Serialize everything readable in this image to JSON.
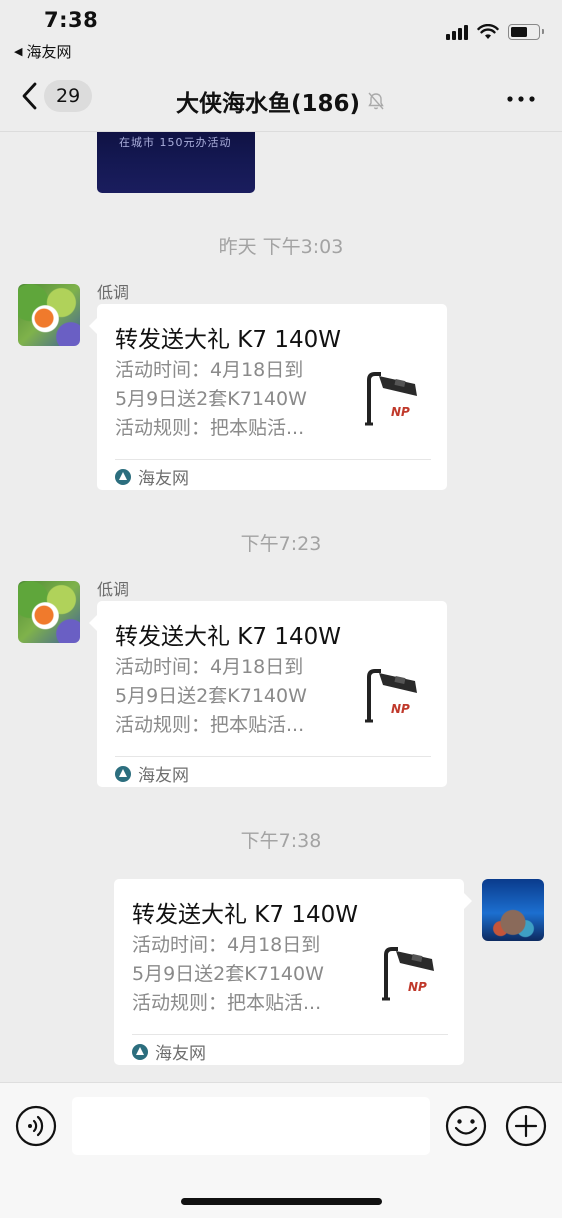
{
  "status_bar": {
    "time": "7:38",
    "back_app": "海友网"
  },
  "nav": {
    "unread_count": "29",
    "title": "大侠海水鱼(186)"
  },
  "top_image_caption": "在城市 150元办活动",
  "messages": [
    {
      "timestamp": "昨天 下午3:03",
      "sender": "低调",
      "title": "转发送大礼 K7 140W",
      "desc": [
        "活动时间：4月18日到",
        "5月9日送2套K7140W",
        "活动规则：把本贴活..."
      ],
      "thumb_label": "NP",
      "source": "海友网"
    },
    {
      "timestamp": "下午7:23",
      "sender": "低调",
      "title": "转发送大礼 K7 140W",
      "desc": [
        "活动时间：4月18日到",
        "5月9日送2套K7140W",
        "活动规则：把本贴活..."
      ],
      "thumb_label": "NP",
      "source": "海友网"
    },
    {
      "timestamp": "下午7:38",
      "sender": "",
      "title": "转发送大礼 K7 140W",
      "desc": [
        "活动时间：4月18日到",
        "5月9日送2套K7140W",
        "活动规则：把本贴活..."
      ],
      "thumb_label": "NP",
      "source": "海友网"
    }
  ],
  "input": {
    "value": "",
    "placeholder": ""
  },
  "icons": {
    "back": "chevron-left-icon",
    "mute": "bell-slash-icon",
    "more": "more-dots-icon",
    "voice": "voice-icon",
    "emoji": "emoji-icon",
    "plus": "plus-icon"
  },
  "colors": {
    "background": "#ededed",
    "card": "#ffffff",
    "timestamp": "#a3a3a3",
    "source_logo": "#2c6e7e"
  }
}
